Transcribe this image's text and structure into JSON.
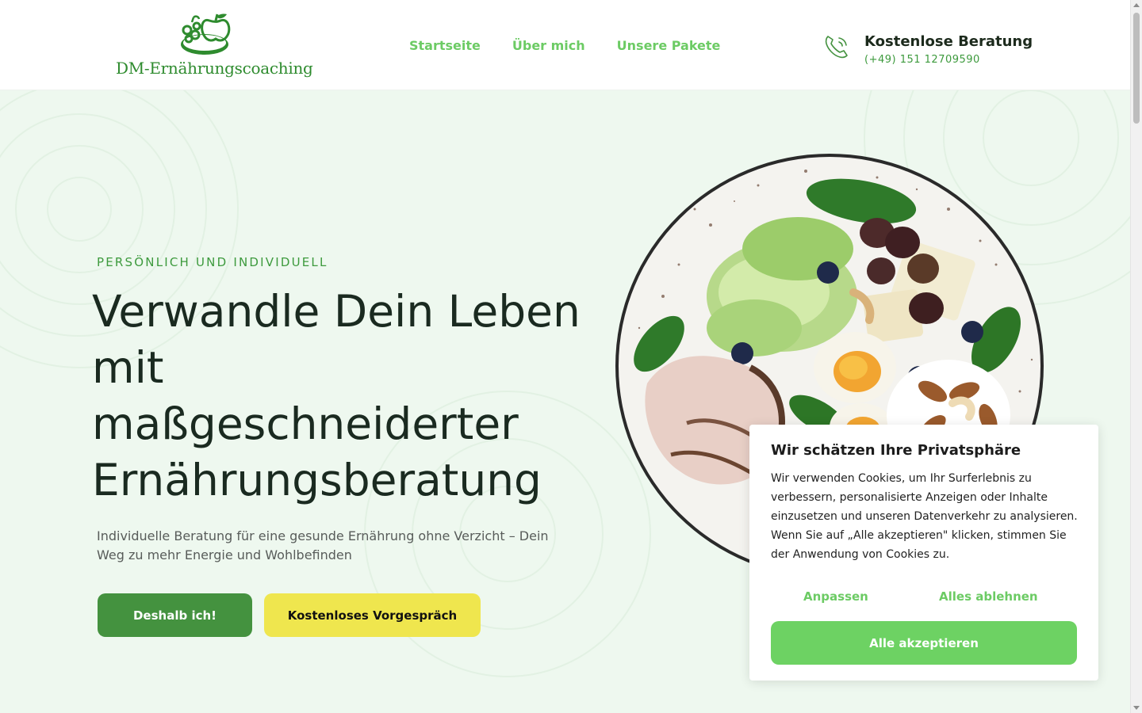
{
  "header": {
    "logo_text": "DM-Ernährungscoaching",
    "nav": [
      {
        "label": "Startseite"
      },
      {
        "label": "Über mich"
      },
      {
        "label": "Unsere Pakete"
      }
    ],
    "contact": {
      "title": "Kostenlose Beratung",
      "phone": "(+49) 151 12709590",
      "icon": "phone-icon"
    }
  },
  "hero": {
    "eyebrow": "PERSÖNLICH UND INDIVIDUELL",
    "headline": "Verwandle Dein Leben mit maßgeschneiderter Ernährungsberatung",
    "subline": "Individuelle Beratung für eine gesunde Ernährung ohne Verzicht – Dein Weg zu mehr Energie und Wohlbefinden",
    "primary_button": "Deshalb ich!",
    "secondary_button": "Kostenloses Vorgespräch",
    "image": "salad-bowl-plate"
  },
  "cookie_banner": {
    "title": "Wir schätzen Ihre Privatsphäre",
    "text": "Wir verwenden Cookies, um Ihr Surferlebnis zu verbessern, personalisierte Anzeigen oder Inhalte einzusetzen und unseren Datenverkehr zu analysieren. Wenn Sie auf „Alle akzeptieren\" klicken, stimmen Sie der Anwendung von Cookies zu.",
    "customize_label": "Anpassen",
    "reject_label": "Alles ablehnen",
    "accept_label": "Alle akzeptieren"
  },
  "colors": {
    "brand_green": "#44923f",
    "nav_green": "#6ccb64",
    "accent_yellow": "#efe64e",
    "hero_bg": "#eef8ef",
    "accept_green": "#6dd263"
  }
}
